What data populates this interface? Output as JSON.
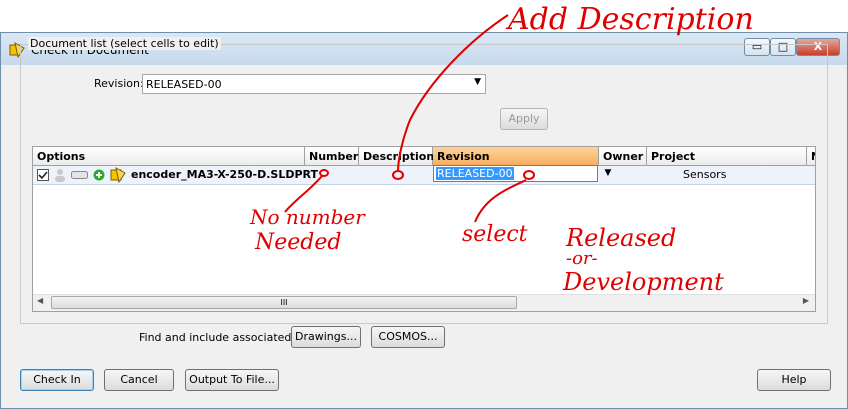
{
  "window": {
    "title": "Check In Document",
    "minimize": "▭",
    "maximize": "□",
    "close": "X"
  },
  "group": {
    "label": "Document list (select cells to edit)"
  },
  "revision_bar": {
    "label": "Revision:",
    "value": "RELEASED-00",
    "apply_label": "Apply"
  },
  "grid": {
    "columns": [
      "Options",
      "Number",
      "Description",
      "Revision",
      "Owner",
      "Project",
      "N"
    ],
    "rows": [
      {
        "name": "encoder_MA3-X-250-D.SLDPRT",
        "number": "",
        "description": "",
        "revision": "RELEASED-00",
        "owner": "",
        "project": "Sensors"
      }
    ],
    "scroll_thumb": "III"
  },
  "find": {
    "label": "Find and include associated:",
    "drawings": "Drawings...",
    "cosmos": "COSMOS..."
  },
  "footer": {
    "check_in": "Check In",
    "cancel": "Cancel",
    "output": "Output To File...",
    "help": "Help"
  },
  "annotations": {
    "add_description": "Add Description",
    "no_number": "No number",
    "needed": "Needed",
    "select": "select",
    "released": "Released",
    "or": "-or-",
    "development": "Development"
  },
  "colors": {
    "annotation": "#e00000",
    "selected_header": "#f8ae62",
    "selection": "#3399ff"
  }
}
